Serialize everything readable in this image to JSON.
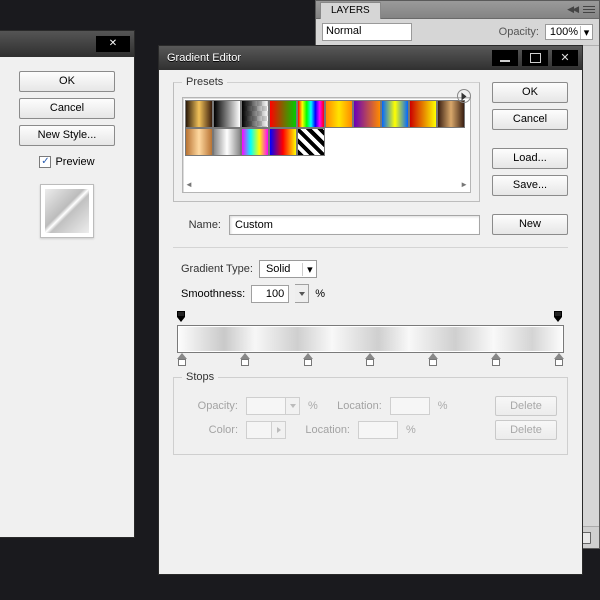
{
  "layers": {
    "tab": "LAYERS",
    "blend_mode": "Normal",
    "opacity_label": "Opacity:",
    "opacity_value": "100%"
  },
  "parent_dialog": {
    "ok": "OK",
    "cancel": "Cancel",
    "new_style": "New Style...",
    "preview_label": "Preview",
    "preview_checked": true
  },
  "gradient_editor": {
    "title": "Gradient Editor",
    "presets_label": "Presets",
    "buttons": {
      "ok": "OK",
      "cancel": "Cancel",
      "load": "Load...",
      "save": "Save...",
      "new": "New"
    },
    "name_label": "Name:",
    "name_value": "Custom",
    "gradient_type_label": "Gradient Type:",
    "gradient_type_value": "Solid",
    "smoothness_label": "Smoothness:",
    "smoothness_value": "100",
    "percent": "%",
    "stops": {
      "label": "Stops",
      "opacity_label": "Opacity:",
      "location_label": "Location:",
      "color_label": "Color:",
      "delete": "Delete"
    }
  }
}
